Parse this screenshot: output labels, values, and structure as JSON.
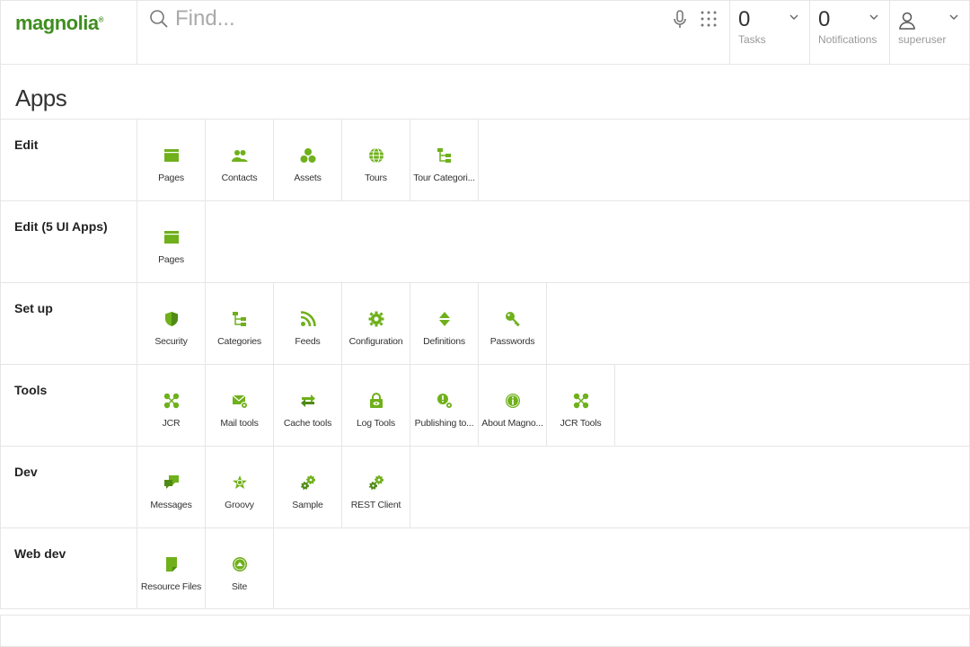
{
  "brand": {
    "name": "magnolia",
    "mark": "®"
  },
  "search": {
    "placeholder": "Find..."
  },
  "tasks": {
    "count": "0",
    "label": "Tasks"
  },
  "notifications": {
    "count": "0",
    "label": "Notifications"
  },
  "user": {
    "label": "superuser"
  },
  "page": {
    "title": "Apps"
  },
  "accent_color": "#6fb01b",
  "groups": [
    {
      "label": "Edit",
      "apps": [
        {
          "label": "Pages",
          "icon": "pages-icon"
        },
        {
          "label": "Contacts",
          "icon": "contacts-icon"
        },
        {
          "label": "Assets",
          "icon": "assets-icon"
        },
        {
          "label": "Tours",
          "icon": "globe-icon"
        },
        {
          "label": "Tour Categori...",
          "icon": "tree-icon"
        }
      ]
    },
    {
      "label": "Edit (5 UI Apps)",
      "apps": [
        {
          "label": "Pages",
          "icon": "pages-icon"
        }
      ]
    },
    {
      "label": "Set up",
      "apps": [
        {
          "label": "Security",
          "icon": "shield-icon"
        },
        {
          "label": "Categories",
          "icon": "tree-icon"
        },
        {
          "label": "Feeds",
          "icon": "rss-icon"
        },
        {
          "label": "Configuration",
          "icon": "gear-icon"
        },
        {
          "label": "Definitions",
          "icon": "definitions-icon"
        },
        {
          "label": "Passwords",
          "icon": "key-icon"
        }
      ]
    },
    {
      "label": "Tools",
      "apps": [
        {
          "label": "JCR",
          "icon": "jcr-icon"
        },
        {
          "label": "Mail tools",
          "icon": "mail-icon"
        },
        {
          "label": "Cache tools",
          "icon": "cache-icon"
        },
        {
          "label": "Log Tools",
          "icon": "log-icon"
        },
        {
          "label": "Publishing to...",
          "icon": "publishing-icon"
        },
        {
          "label": "About Magno...",
          "icon": "info-icon"
        },
        {
          "label": "JCR Tools",
          "icon": "jcr-icon"
        }
      ]
    },
    {
      "label": "Dev",
      "apps": [
        {
          "label": "Messages",
          "icon": "messages-icon"
        },
        {
          "label": "Groovy",
          "icon": "groovy-icon"
        },
        {
          "label": "Sample",
          "icon": "gears-icon"
        },
        {
          "label": "REST Client",
          "icon": "gears-icon"
        }
      ]
    },
    {
      "label": "Web dev",
      "apps": [
        {
          "label": "Resource Files",
          "icon": "file-icon"
        },
        {
          "label": "Site",
          "icon": "site-icon"
        }
      ]
    }
  ]
}
